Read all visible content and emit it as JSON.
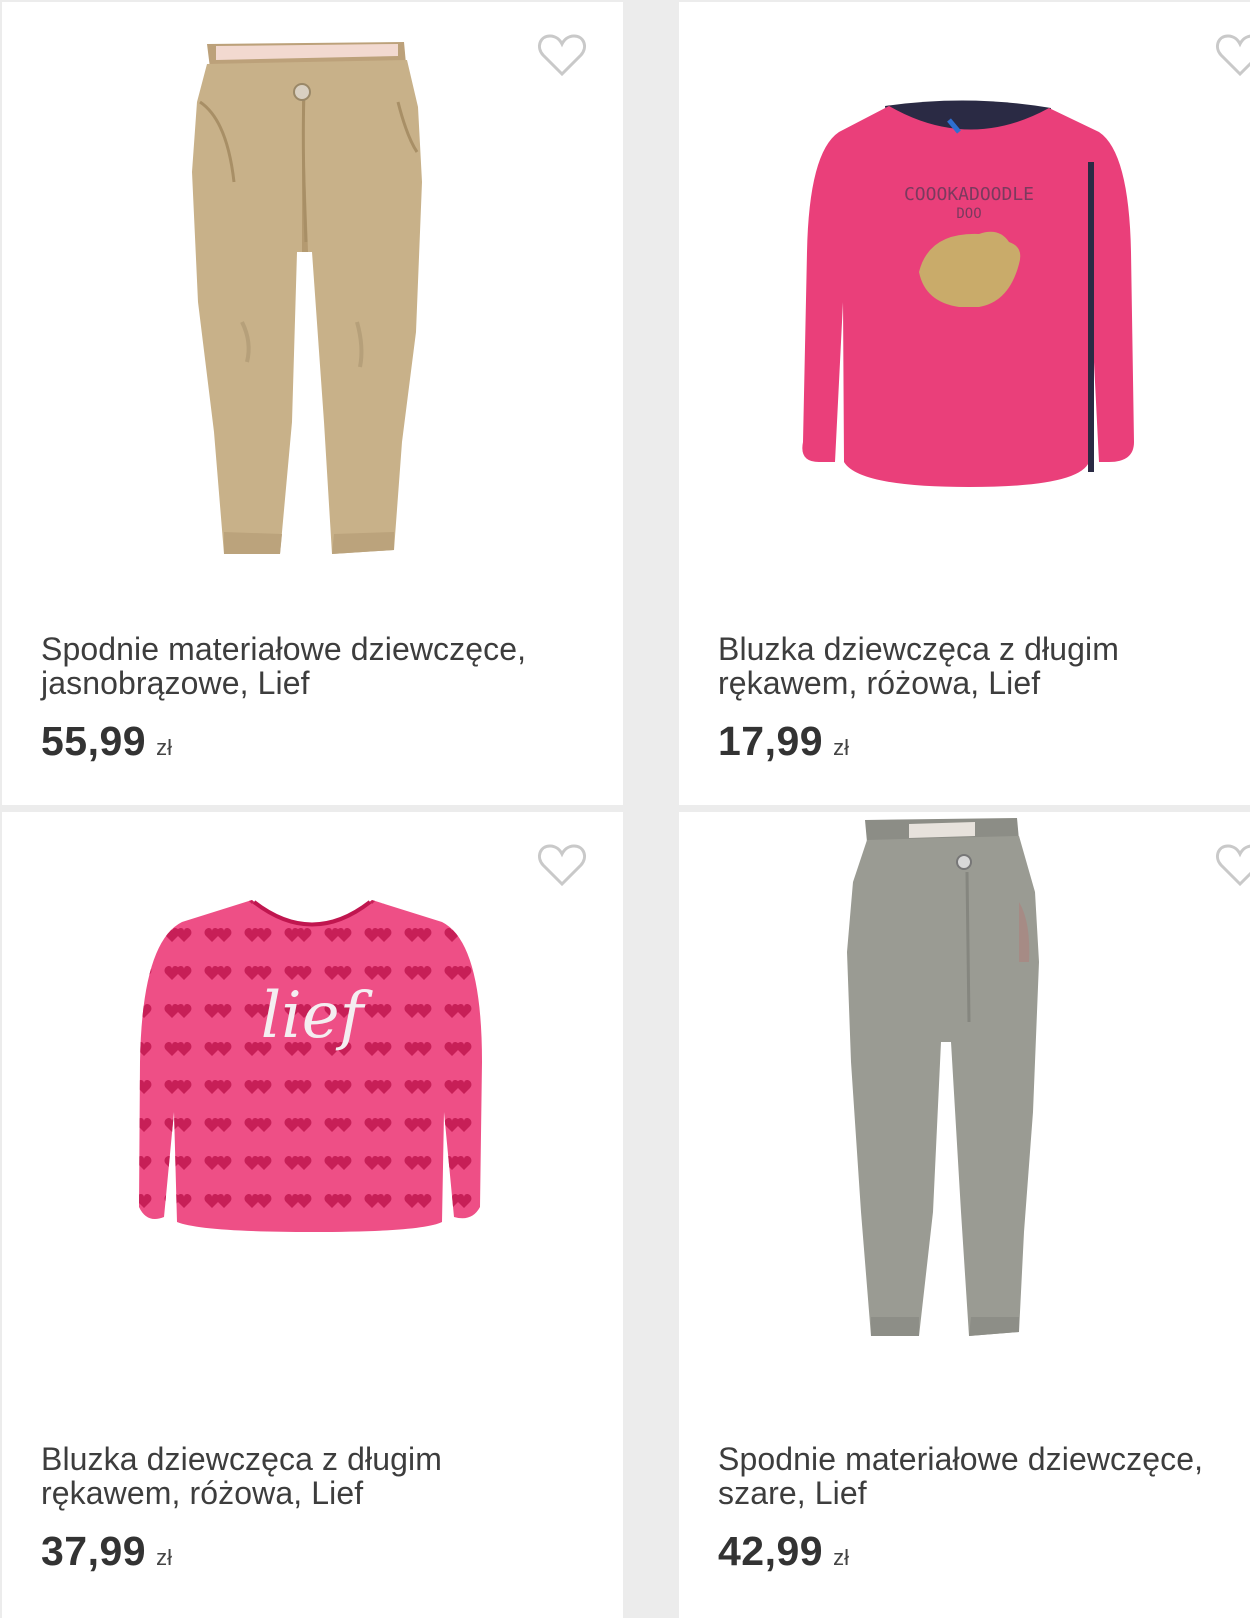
{
  "products": [
    {
      "title": "Spodnie materiałowe dziewczęce, jasnobrązowe, Lief",
      "price": "55,99",
      "currency": "zł",
      "image": "beige-pants",
      "color": "#c8b189"
    },
    {
      "title": "Bluzka dziewczęca z długim rękawem, różowa, Lief",
      "price": "17,99",
      "currency": "zł",
      "image": "pink-shirt-rooster",
      "color": "#ea3f7a"
    },
    {
      "title": "Bluzka dziewczęca z długim rękawem, różowa, Lief",
      "price": "37,99",
      "currency": "zł",
      "image": "pink-shirt-hearts",
      "color": "#ee4f86"
    },
    {
      "title": "Spodnie materiałowe dziewczęce, szare, Lief",
      "price": "42,99",
      "currency": "zł",
      "image": "grey-pants",
      "color": "#9a9b93"
    }
  ],
  "print_text": {
    "rooster_line1": "COOOKADOODLE",
    "rooster_line2": "DOO",
    "hearts_script": "lief"
  },
  "icons": {
    "favorite": "heart-outline-icon"
  }
}
